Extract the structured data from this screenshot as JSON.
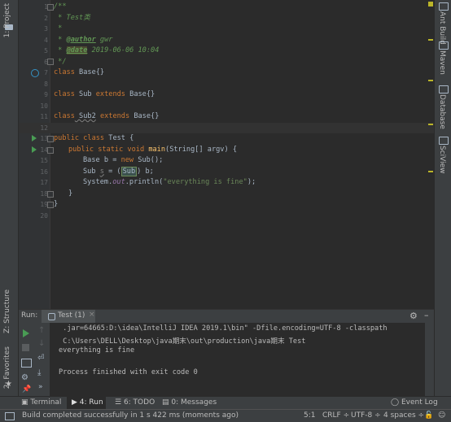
{
  "left_stripe": {
    "project_label": "1: Project",
    "structure_label": "Z: Structure",
    "favorites_label": "2: Favorites"
  },
  "right_stripe": {
    "items": [
      "Ant Build",
      "Maven",
      "Database",
      "SciView"
    ]
  },
  "editor": {
    "lines": [
      {
        "n": "1"
      },
      {
        "n": "2"
      },
      {
        "n": "3"
      },
      {
        "n": "4"
      },
      {
        "n": "5"
      },
      {
        "n": "6"
      },
      {
        "n": "7"
      },
      {
        "n": "8"
      },
      {
        "n": "9"
      },
      {
        "n": "10"
      },
      {
        "n": "11"
      },
      {
        "n": "12"
      },
      {
        "n": "13"
      },
      {
        "n": "14"
      },
      {
        "n": "15"
      },
      {
        "n": "16"
      },
      {
        "n": "17"
      },
      {
        "n": "18"
      },
      {
        "n": "19"
      },
      {
        "n": "20"
      }
    ],
    "code": {
      "l1": "/**",
      "l2": " * Test类",
      "l3": " *",
      "l4_tag": "@author",
      "l4_val": " gwr",
      "l5_tag": "@date",
      "l5_val": " 2019-06-06 10:04",
      "l6": " */",
      "l7_kw": "class",
      "l7_rest": " Base{}",
      "l9_kw1": "class",
      "l9_mid": " Sub ",
      "l9_kw2": "extends",
      "l9_rest": " Base{}",
      "l11_kw1": "class",
      "l11_name": " Sub2",
      "l11_kw2": "extends",
      "l11_rest": " Base{}",
      "l13_kw": "public class",
      "l13_rest": " Test {",
      "l14_kw": "public static void",
      "l14_fn": "main",
      "l14_rest": "(String[] argv) {",
      "l15_a": "Base b = ",
      "l15_kw": "new",
      "l15_b": " Sub();",
      "l16_a": "Sub ",
      "l16_var": "s",
      "l16_b": " = (",
      "l16_hl": "Sub",
      "l16_c": ") b;",
      "l17_a": "System.",
      "l17_st": "out",
      "l17_b": ".println(",
      "l17_str": "\"everything is fine\"",
      "l17_c": ");",
      "l18": "}",
      "l19": "}"
    }
  },
  "run": {
    "label": "Run:",
    "tab_label": "Test (1)",
    "console": [
      " .jar=64665:D:\\idea\\IntelliJ IDEA 2019.1\\bin\" -Dfile.encoding=UTF-8 -classpath",
      " C:\\Users\\DELL\\Desktop\\java期末\\out\\production\\java期末 Test",
      "everything is fine",
      "",
      "Process finished with exit code 0"
    ]
  },
  "bottom_tabs": {
    "terminal": "Terminal",
    "run": "4: Run",
    "todo": "6: TODO",
    "messages": "0: Messages",
    "event_log": "Event Log"
  },
  "status": {
    "message": "Build completed successfully in 1 s 422 ms (moments ago)",
    "position": "5:1",
    "line_sep": "CRLF",
    "encoding": "UTF-8",
    "indent": "4 spaces"
  },
  "colors": {
    "run_green": "#499c54",
    "keyword": "#cc7832",
    "comment": "#629755",
    "string": "#6a8759"
  }
}
